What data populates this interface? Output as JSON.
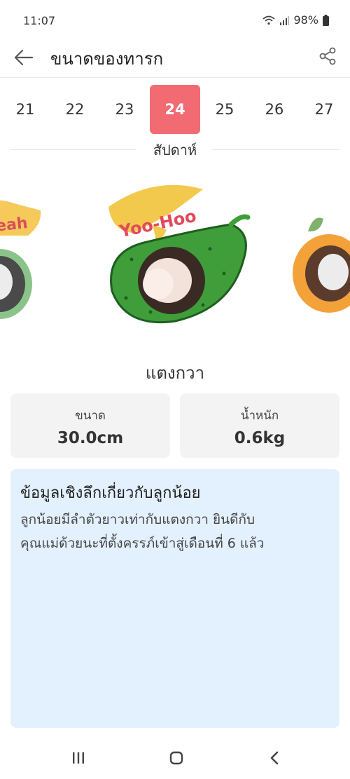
{
  "status_bar": {
    "time": "11:07",
    "battery": "98%"
  },
  "header": {
    "title": "ขนาดของทารก"
  },
  "weeks": {
    "items": [
      "21",
      "22",
      "23",
      "24",
      "25",
      "26",
      "27"
    ],
    "selected": "24",
    "label": "สัปดาห์"
  },
  "illustration": {
    "speech_text": "Yoo-Hoo",
    "left_partial_text": "eah"
  },
  "fruit": {
    "name": "แตงกวา"
  },
  "stats": {
    "size": {
      "label": "ขนาด",
      "value": "30.0cm"
    },
    "weight": {
      "label": "น้ำหนัก",
      "value": "0.6kg"
    }
  },
  "info": {
    "title": "ข้อมูลเชิงลึกเกี่ยวกับลูกน้อย",
    "line1": "ลูกน้อยมีลำตัวยาวเท่ากับแตงกวา ยินดีกับ",
    "line2": "คุณแม่ด้วยนะที่ตั้งครรภ์เข้าสู่เดือนที่ 6 แล้ว"
  },
  "colors": {
    "accent": "#f26b73",
    "info_bg": "#e3f0fd",
    "card_bg": "#f3f3f3"
  }
}
